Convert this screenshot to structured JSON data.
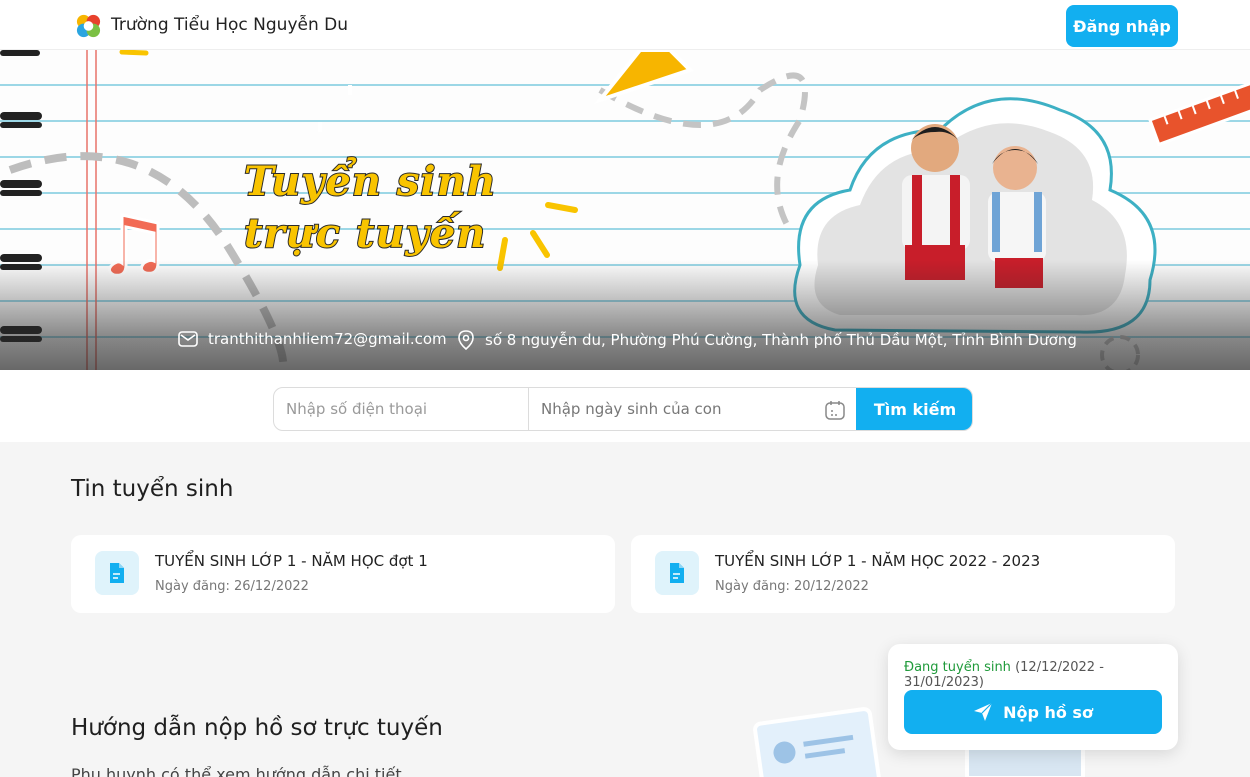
{
  "header": {
    "school_name": "Trường Tiểu Học Nguyễn Du",
    "login_label": "Đăng nhập"
  },
  "hero": {
    "title_line1": "Tuyển sinh",
    "title_line2": "trực tuyến",
    "email": "tranthithanhliem72@gmail.com",
    "address": "số 8 nguyễn du, Phường Phú Cường, Thành phố Thủ Dầu Một, Tỉnh Bình Dương"
  },
  "search": {
    "phone_placeholder": "Nhập số điện thoại",
    "dob_placeholder": "Nhập ngày sinh của con",
    "button_label": "Tìm kiếm"
  },
  "news": {
    "title": "Tin tuyển sinh",
    "items": [
      {
        "title": "TUYỂN SINH LỚP 1 - NĂM HỌC đợt 1",
        "date": "Ngày đăng: 26/12/2022"
      },
      {
        "title": "TUYỂN SINH LỚP 1 - NĂM HỌC 2022 - 2023",
        "date": "Ngày đăng: 20/12/2022"
      }
    ]
  },
  "apply": {
    "status": "Đang tuyển sinh",
    "range": "(12/12/2022 - 31/01/2023)",
    "button_label": "Nộp hồ sơ"
  },
  "guide": {
    "title": "Hướng dẫn nộp hồ sơ trực tuyến",
    "subtitle": "Phụ huynh có thể xem hướng dẫn chi tiết"
  },
  "colors": {
    "primary": "#12aff0",
    "status_green": "#1f9a3a",
    "title_yellow": "#f9c400"
  }
}
